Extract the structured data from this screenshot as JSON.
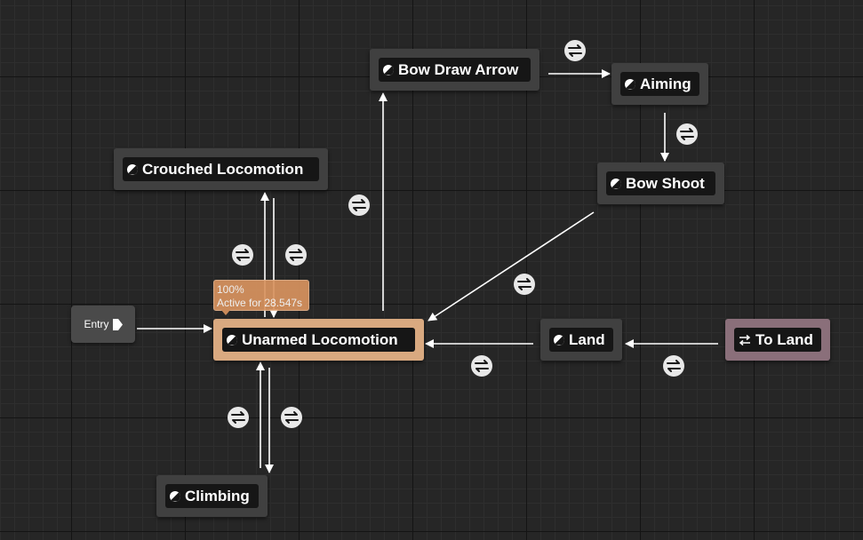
{
  "graph": {
    "entry": {
      "label": "Entry"
    },
    "states": [
      {
        "id": "crouched",
        "label": "Crouched Locomotion",
        "kind": "state"
      },
      {
        "id": "bowdraw",
        "label": "Bow Draw Arrow",
        "kind": "state"
      },
      {
        "id": "aiming",
        "label": "Aiming",
        "kind": "state"
      },
      {
        "id": "bowshoot",
        "label": "Bow Shoot",
        "kind": "state"
      },
      {
        "id": "unarmed",
        "label": "Unarmed Locomotion",
        "kind": "state",
        "active": true
      },
      {
        "id": "land",
        "label": "Land",
        "kind": "state"
      },
      {
        "id": "toland",
        "label": "To Land",
        "kind": "conduit"
      },
      {
        "id": "climbing",
        "label": "Climbing",
        "kind": "state"
      }
    ],
    "active_tooltip": {
      "percent": "100%",
      "active_for": "Active for 28.547s"
    },
    "transitions": [
      {
        "from": "entry",
        "to": "unarmed"
      },
      {
        "from": "unarmed",
        "to": "crouched"
      },
      {
        "from": "crouched",
        "to": "unarmed"
      },
      {
        "from": "unarmed",
        "to": "bowdraw"
      },
      {
        "from": "bowdraw",
        "to": "aiming"
      },
      {
        "from": "aiming",
        "to": "bowshoot"
      },
      {
        "from": "bowshoot",
        "to": "unarmed"
      },
      {
        "from": "toland",
        "to": "land"
      },
      {
        "from": "land",
        "to": "unarmed"
      },
      {
        "from": "unarmed",
        "to": "climbing"
      },
      {
        "from": "climbing",
        "to": "unarmed"
      }
    ],
    "colors": {
      "background": "#262626",
      "state_node": "#404040",
      "active_node": "#d9a980",
      "conduit_node": "#8a6f7a",
      "tooltip": "#d8935f",
      "arrow": "#ffffff"
    },
    "icons": {
      "state": "half-circle-state-icon",
      "conduit": "conduit-arrows-icon",
      "transition": "transition-rule-icon",
      "entry": "entry-arrow-icon"
    }
  }
}
